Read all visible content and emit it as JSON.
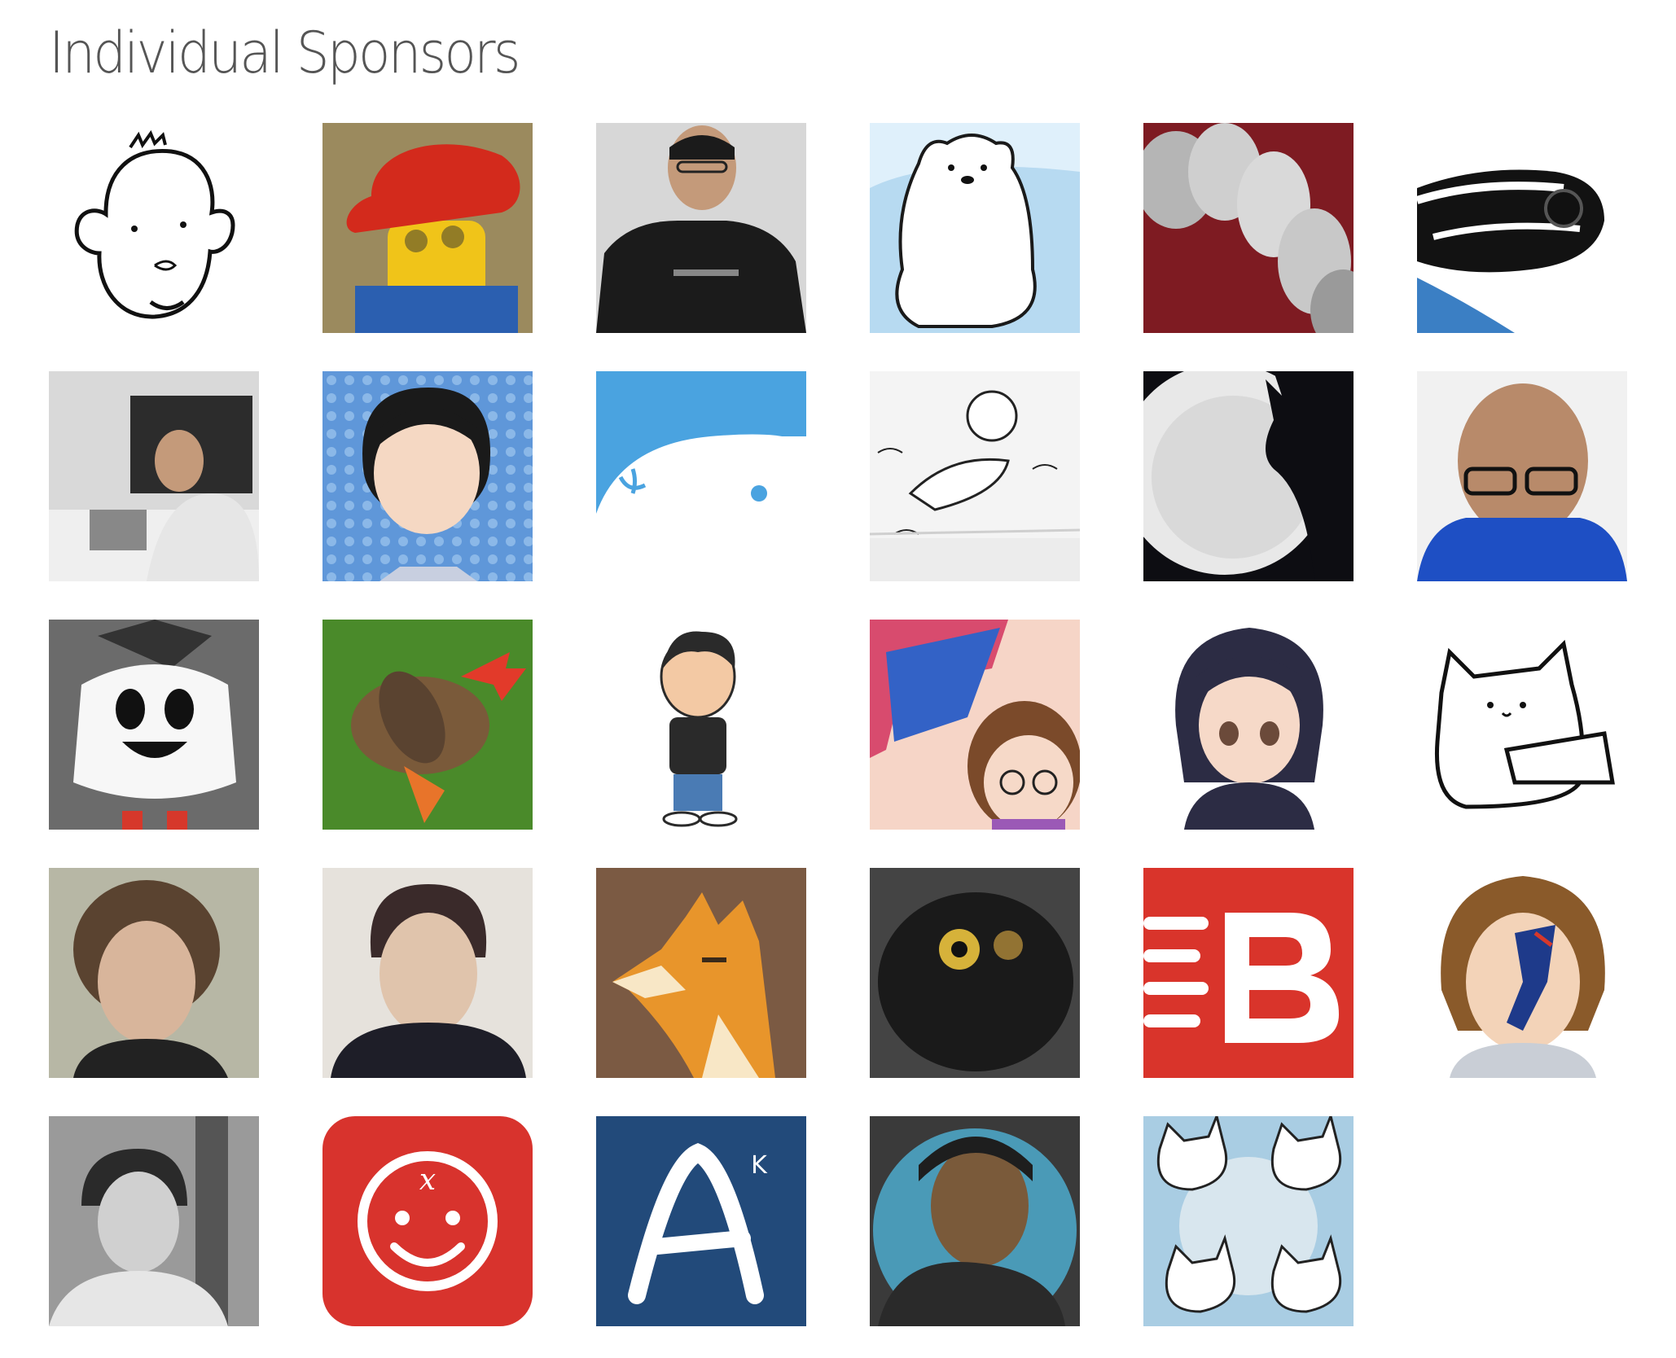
{
  "section": {
    "title": "Individual Sponsors"
  },
  "sponsors": [
    {
      "icon": "face-sketch-avatar",
      "colors": [
        "#ffffff",
        "#111111",
        "#f2f2f2"
      ]
    },
    {
      "icon": "lego-figure-red-cap-avatar",
      "colors": [
        "#9b8a5e",
        "#d32a1c",
        "#f0c419",
        "#2b5fb0"
      ]
    },
    {
      "icon": "man-black-tshirt-avatar",
      "colors": [
        "#d7d7d7",
        "#1b1b1b",
        "#c49a7a"
      ]
    },
    {
      "icon": "polar-bear-drawing-avatar",
      "colors": [
        "#dff0fb",
        "#ffffff",
        "#1a1a1a",
        "#8fc4e8"
      ]
    },
    {
      "icon": "gray-segmented-shapes-avatar",
      "colors": [
        "#7e1b22",
        "#d9d9d9",
        "#9a9a9a"
      ]
    },
    {
      "icon": "poison-frog-avatar",
      "colors": [
        "#ffffff",
        "#121212",
        "#3b7fc4"
      ]
    },
    {
      "icon": "man-at-computer-avatar",
      "colors": [
        "#d9d9d9",
        "#2c2c2c",
        "#efefef"
      ]
    },
    {
      "icon": "cartoon-girl-blue-dots-avatar",
      "colors": [
        "#5f97d9",
        "#8bb8e8",
        "#f5d8c3",
        "#1a1a1a"
      ]
    },
    {
      "icon": "white-seal-blue-avatar",
      "colors": [
        "#4aa3e0",
        "#ffffff"
      ]
    },
    {
      "icon": "bear-sketch-avatar",
      "colors": [
        "#f4f4f4",
        "#222222",
        "#cfcfcf"
      ]
    },
    {
      "icon": "cat-silhouette-moon-avatar",
      "colors": [
        "#0d0d12",
        "#e8e8e8",
        "#8a8a8a"
      ]
    },
    {
      "icon": "bald-man-glasses-avatar",
      "colors": [
        "#f1f1f1",
        "#1e4fc4",
        "#b88a6a"
      ]
    },
    {
      "icon": "ghost-costume-avatar",
      "colors": [
        "#6b6b6b",
        "#f7f7f7",
        "#111111"
      ]
    },
    {
      "icon": "duck-on-grass-avatar",
      "colors": [
        "#4a8a2a",
        "#7a5a3a",
        "#e23a2a"
      ]
    },
    {
      "icon": "peanuts-style-boy-avatar",
      "colors": [
        "#ffffff",
        "#2a2a2a",
        "#4a7bb4",
        "#f3c9a4"
      ]
    },
    {
      "icon": "comic-girl-glasses-avatar",
      "colors": [
        "#f6d5c7",
        "#d84b6e",
        "#3362c6",
        "#7b4a2a"
      ]
    },
    {
      "icon": "anime-girl-avatar",
      "colors": [
        "#ffffff",
        "#2c2c44",
        "#f6d9c8"
      ]
    },
    {
      "icon": "white-cat-laptop-avatar",
      "colors": [
        "#ffffff",
        "#111111"
      ]
    },
    {
      "icon": "curly-hair-man-avatar",
      "colors": [
        "#b7b7a5",
        "#5a4330",
        "#d8b59b"
      ]
    },
    {
      "icon": "dark-hair-man-avatar",
      "colors": [
        "#e6e2dc",
        "#3a2a2a",
        "#e0c4ac"
      ]
    },
    {
      "icon": "pixel-fox-avatar",
      "colors": [
        "#7b5a43",
        "#e8952b",
        "#f8e7c6"
      ]
    },
    {
      "icon": "black-fluffy-owl-avatar",
      "colors": [
        "#444444",
        "#1a1a1a",
        "#d6b23a"
      ]
    },
    {
      "icon": "red-b-logo-avatar",
      "colors": [
        "#d9342b",
        "#ffffff"
      ]
    },
    {
      "icon": "cartoon-man-flag-face-avatar",
      "colors": [
        "#ffffff",
        "#8a5a2a",
        "#1e3a8a",
        "#d6382b"
      ]
    },
    {
      "icon": "man-glasses-monochrome-avatar",
      "colors": [
        "#9a9a9a",
        "#2a2a2a",
        "#e6e6e6"
      ]
    },
    {
      "icon": "red-smiley-logo-avatar",
      "colors": [
        "#d8332d",
        "#ffffff"
      ]
    },
    {
      "icon": "navy-a-logo-avatar",
      "colors": [
        "#224a7a",
        "#ffffff"
      ]
    },
    {
      "icon": "bearded-man-illustration-avatar",
      "colors": [
        "#3a3a3a",
        "#4a9ab7",
        "#7a5a3a"
      ]
    },
    {
      "icon": "white-cats-pattern-avatar",
      "colors": [
        "#a9cde3",
        "#ffffff",
        "#222222"
      ]
    }
  ]
}
